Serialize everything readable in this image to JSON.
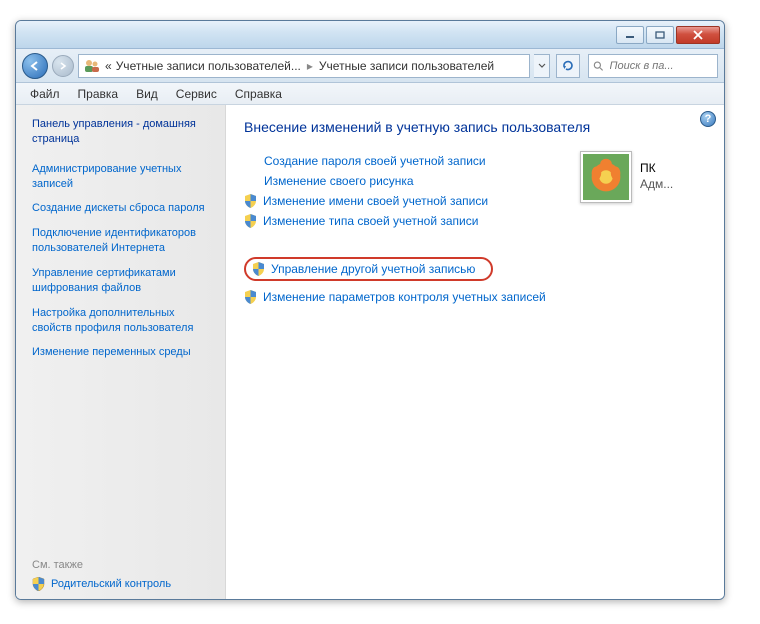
{
  "titlebar": {},
  "breadcrumb": {
    "prefix": "«",
    "part1": "Учетные записи пользователей...",
    "part2": "Учетные записи пользователей"
  },
  "search": {
    "placeholder": "Поиск в па..."
  },
  "menu": {
    "file": "Файл",
    "edit": "Правка",
    "view": "Вид",
    "service": "Сервис",
    "help": "Справка"
  },
  "sidebar": {
    "home": "Панель управления - домашняя страница",
    "links": [
      "Администрирование учетных записей",
      "Создание дискеты сброса пароля",
      "Подключение идентификаторов пользователей Интернета",
      "Управление сертификатами шифрования файлов",
      "Настройка дополнительных свойств профиля пользователя",
      "Изменение переменных среды"
    ],
    "see_also": "См. также",
    "parental": "Родительский контроль"
  },
  "main": {
    "title": "Внесение изменений в учетную запись пользователя",
    "links": [
      "Создание пароля своей учетной записи",
      "Изменение своего рисунка",
      "Изменение имени своей учетной записи",
      "Изменение типа своей учетной записи",
      "Управление другой учетной записью",
      "Изменение параметров контроля учетных записей"
    ]
  },
  "account": {
    "name": "ПК",
    "role": "Адм..."
  },
  "help": "?"
}
